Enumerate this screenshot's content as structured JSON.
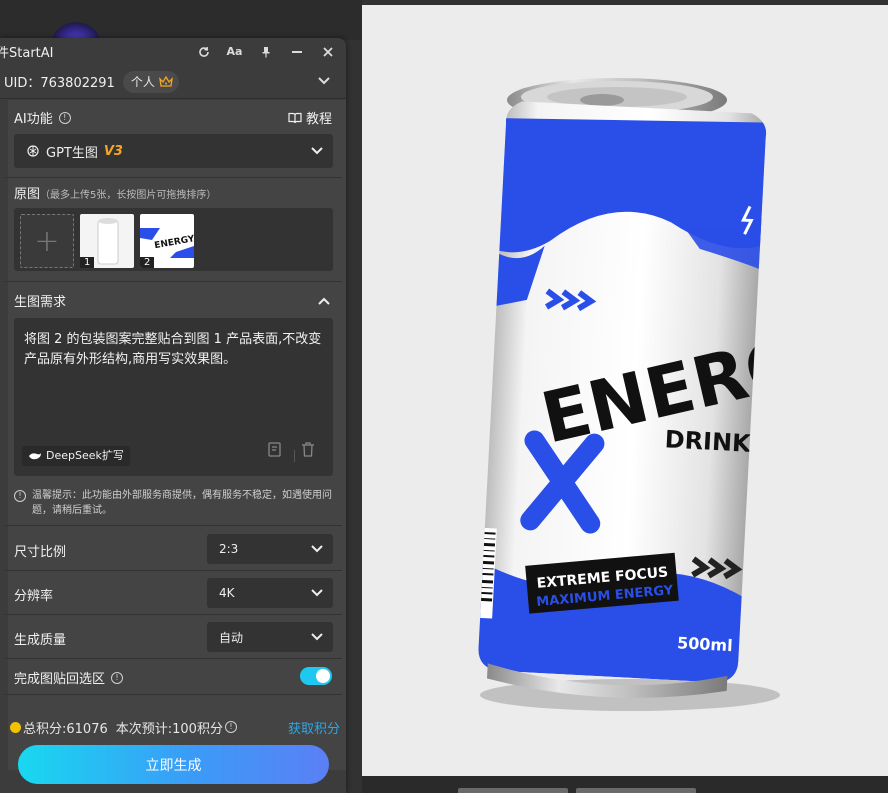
{
  "panel": {
    "title": "件StartAI",
    "uid_text": "UID：763802291",
    "account_badge": "个人",
    "ai_function_label": "AI功能",
    "tutorial_label": "教程",
    "model_select": {
      "name": "GPT生图",
      "version": "V3"
    },
    "source_image": {
      "label": "原图",
      "hint": "（最多上传5张，长按图片可拖拽排序）",
      "thumbnails": [
        {
          "number": "1",
          "kind": "white-can"
        },
        {
          "number": "2",
          "kind": "energy-label",
          "label_text": "ENERGY"
        }
      ]
    },
    "requirement": {
      "label": "生图需求",
      "text": "将图 2 的包装图案完整贴合到图 1 产品表面,不改变产品原有外形结构,商用写实效果图。",
      "deepseek_button": "DeepSeek扩写"
    },
    "tip_text": "温馨提示：此功能由外部服务商提供，偶有服务不稳定，如遇使用问题，请稍后重试。",
    "settings": [
      {
        "label": "尺寸比例",
        "value": "2:3"
      },
      {
        "label": "分辨率",
        "value": "4K"
      },
      {
        "label": "生成质量",
        "value": "自动"
      }
    ],
    "paste_back": {
      "label": "完成图贴回选区",
      "enabled": true
    },
    "points": {
      "total": "总积分:61076",
      "estimate": "本次预计:100积分",
      "earn_link": "获取积分"
    },
    "generate_button": "立即生成"
  },
  "canvas": {
    "can_texts": {
      "brand": "ENERGY",
      "sub": "DRINK",
      "tag1": "EXTREME FOCUS",
      "tag2": "MAXIMUM ENERGY",
      "volume": "500ml"
    }
  },
  "colors": {
    "accent_blue": "#2a4ee8",
    "toggle_on": "#1ec8f0",
    "link_blue": "#2fa6e6",
    "version_orange": "#f5a623",
    "coin_gold": "#f2c200"
  }
}
